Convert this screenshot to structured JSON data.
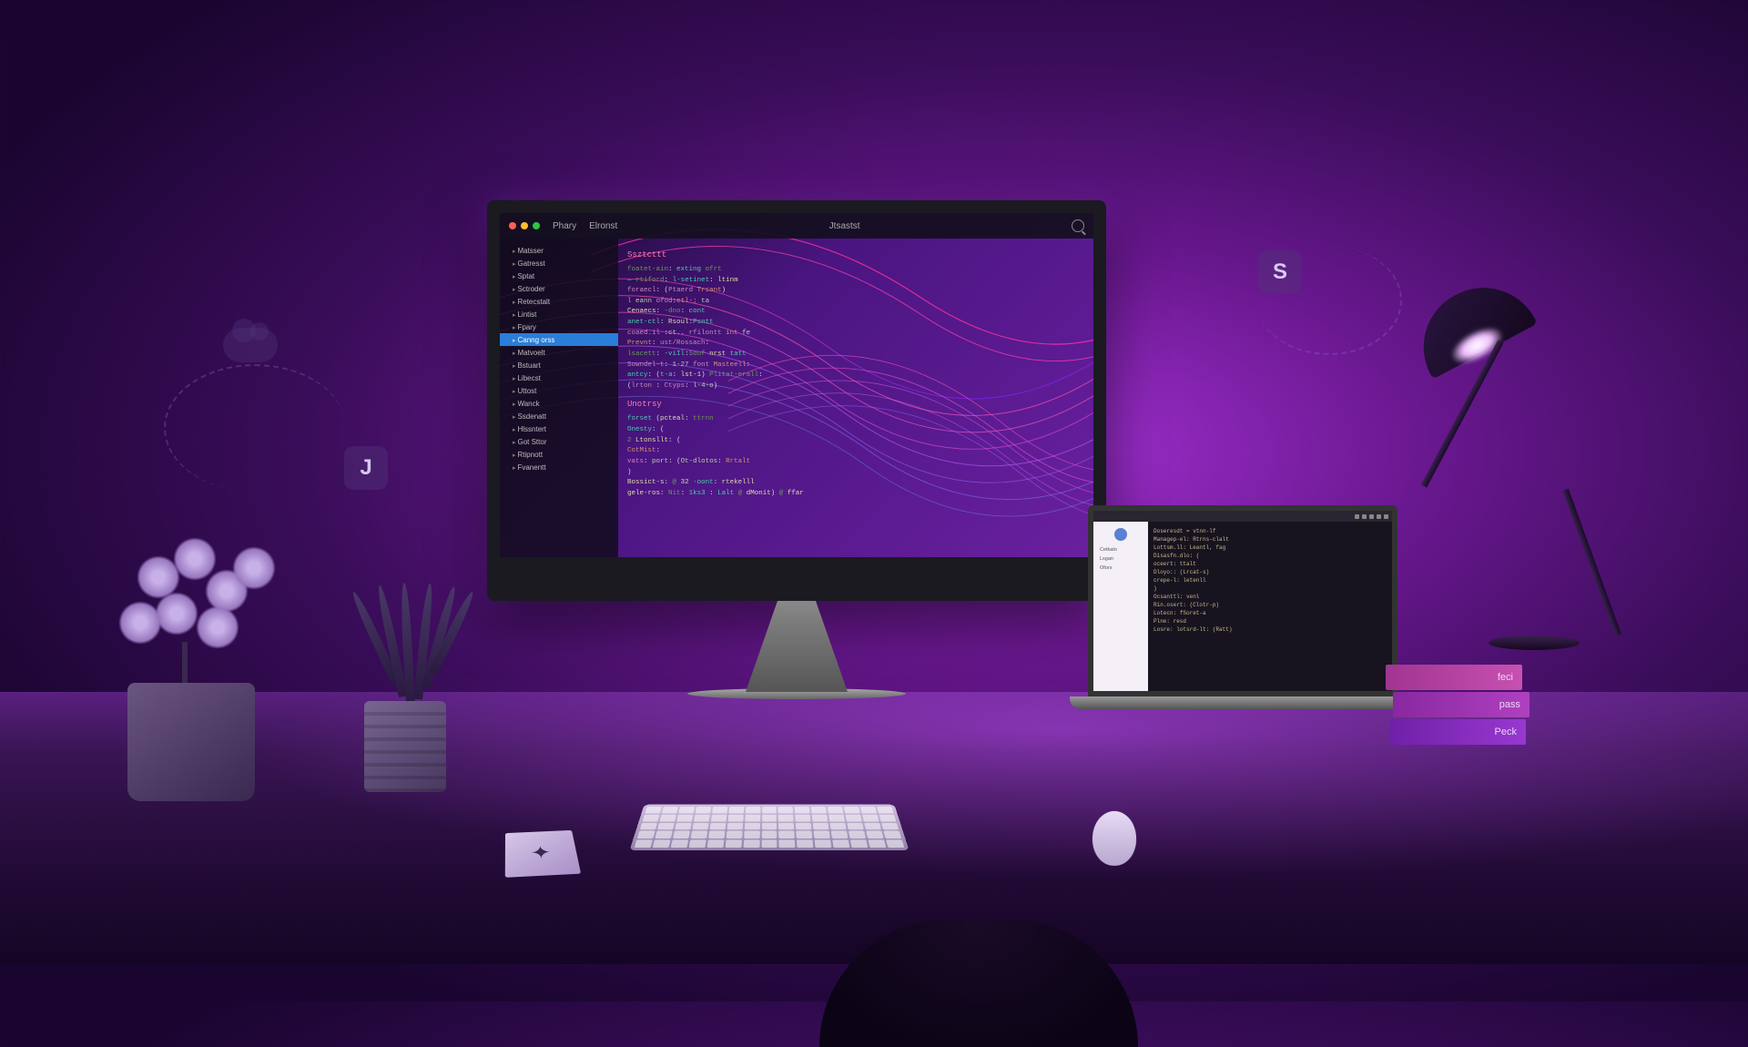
{
  "imac": {
    "topbar": {
      "menu1": "Phary",
      "menu2": "Elronst",
      "title": "Jtsastst"
    },
    "sidebar_items": [
      "Matsser",
      "Gatresst",
      "Sptat",
      "Sctroder",
      "Retecstalt",
      "Lintist",
      "Fpary",
      "Canng orss",
      "Matvoelt",
      "Bstuart",
      "Libecst",
      "Uttost",
      "Wanck",
      "Ssdenatt",
      "Hlssntert",
      "Got Sttor",
      "Rtipnott",
      "Fvanentt"
    ],
    "selected_index": 7,
    "code": {
      "heading1": "Ssztcttt",
      "heading2": "Unotrsy",
      "lines1": [
        "foatet-ain: exting ofrt",
        "— rtiford: l-setinet: ltinm",
        "foraecl: (Ptaerd Trsant)",
        "l eann ofod:etl-; ta",
        "Cenaecs: -dno: cont",
        "anet-ctl: Rsoul:Psntt",
        "",
        "coaed.il :ct.. rfilontt int fe",
        "Prevnt: ust/Rossach:",
        "lsacett: -viIl:Souf nrst tatt",
        "Sowndel-t: 1-27 font Masteell:",
        "antcy: (t-a: lst-1) Plitat-erall:",
        "(lrton : Ctyps: l-4-o)"
      ],
      "lines2": [
        "forset (pcteal: ttrnn",
        "Onesty: (",
        "  2 Ltonsllt: (",
        "    CotMist:",
        "    vats: port: (Ot-dlotos: Rrtalt",
        "  )",
        "Bossict-s: @ 32 -oont: rtekelll",
        "gele-ros: Nit: 1ks3 : Lalt @ dMonit) @ ffar"
      ]
    }
  },
  "laptop": {
    "sidebar_items": [
      "Cetkato",
      "Lsgan",
      "Ofors"
    ],
    "code_lines": [
      "Doseresdt = vtnn-lf",
      "  Managep-el: Rtrns-clalt",
      "  Lottsm.ll: Leantl, fag",
      "Disasfn.dlo: (",
      "  oceert: ttalt",
      "  Dloyo:: (Lrcat-s)",
      "  crepe-l: letenll",
      ")",
      "Ocsanttl: venl",
      "Rin.osert: (Clotr-p)",
      "Lotecn: fSoret-a",
      "  Plne: resd",
      "Losre: lotsrd-lt: (Ratt)"
    ]
  },
  "books": [
    "feci",
    "pass",
    "Peck"
  ],
  "float_icons": {
    "shield": "J",
    "code": "S"
  }
}
